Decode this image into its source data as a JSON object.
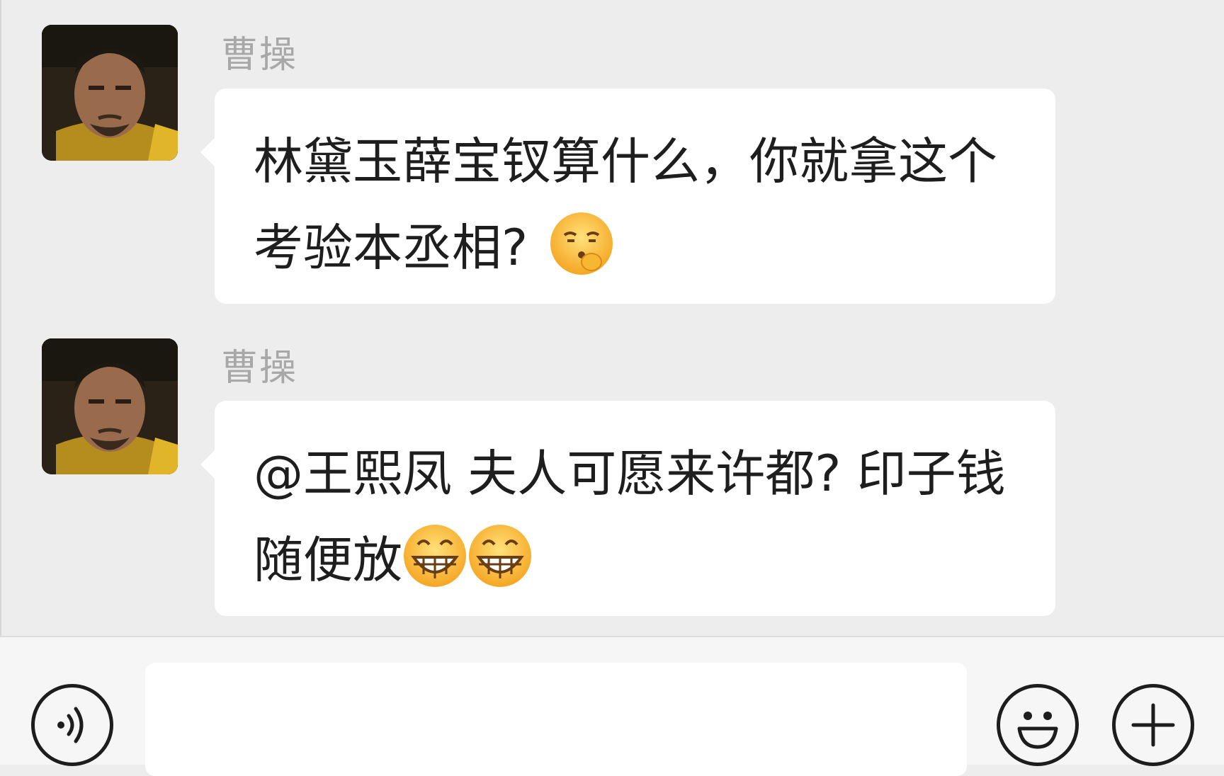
{
  "messages": [
    {
      "sender": "曹操",
      "text": "林黛玉薛宝钗算什么，你就拿这个考验本丞相?",
      "emojis": [
        "shushing-face-emoji"
      ]
    },
    {
      "sender": "曹操",
      "text": "@王熙凤 夫人可愿来许都? 印子钱随便放",
      "emojis": [
        "grinning-face-emoji",
        "grinning-face-emoji"
      ]
    }
  ],
  "input_bar": {
    "message_value": "",
    "voice_icon": "voice-icon",
    "emoji_icon": "emoji-icon",
    "add_icon": "plus-icon"
  },
  "colors": {
    "chat_background": "#ededed",
    "bubble": "#ffffff",
    "sender_name": "#a8a8a8",
    "message_text": "#1e1e1e"
  }
}
